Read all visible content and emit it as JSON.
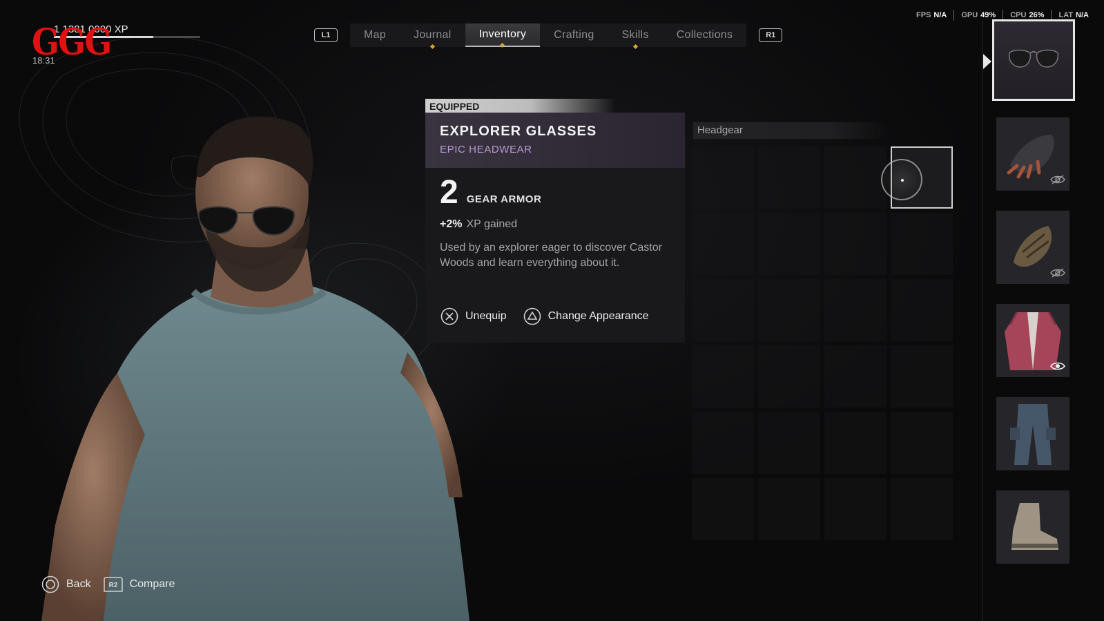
{
  "header": {
    "xp_text": "1 1381  0000 XP",
    "xp_progress": 0.68,
    "time": "18:31",
    "logo_text": "GGG"
  },
  "tabs": {
    "left_bumper": "L1",
    "right_bumper": "R1",
    "items": [
      {
        "label": "Map",
        "active": false,
        "dot": false
      },
      {
        "label": "Journal",
        "active": false,
        "dot": true
      },
      {
        "label": "Inventory",
        "active": true,
        "dot": true
      },
      {
        "label": "Crafting",
        "active": false,
        "dot": false
      },
      {
        "label": "Skills",
        "active": false,
        "dot": true
      },
      {
        "label": "Collections",
        "active": false,
        "dot": false
      }
    ]
  },
  "perf": {
    "fps_label": "FPS",
    "fps_value": "N/A",
    "gpu_label": "GPU",
    "gpu_value": "49%",
    "cpu_label": "CPU",
    "cpu_value": "26%",
    "lat_label": "LAT",
    "lat_value": "N/A"
  },
  "item": {
    "status": "EQUIPPED",
    "name": "EXPLORER GLASSES",
    "rarity": "EPIC HEADWEAR",
    "armor_value": "2",
    "armor_label": "GEAR ARMOR",
    "bonus_value": "+2%",
    "bonus_label": "XP gained",
    "description": "Used by an explorer eager to discover Castor Woods and learn everything about it.",
    "actions": {
      "unequip": "Unequip",
      "change_appearance": "Change Appearance"
    }
  },
  "inventory": {
    "slot_label": "Headgear"
  },
  "equipment": {
    "slots": [
      {
        "name": "glasses",
        "selected": true
      },
      {
        "name": "gloves",
        "visibility": "hidden"
      },
      {
        "name": "arm-guard",
        "visibility": "hidden"
      },
      {
        "name": "jacket",
        "visibility": "visible"
      },
      {
        "name": "pants"
      },
      {
        "name": "boots"
      }
    ]
  },
  "hints": {
    "back": "Back",
    "compare_button": "R2",
    "compare": "Compare"
  },
  "colors": {
    "epic": "#b99ad6",
    "tab_dot": "#d8a431",
    "logo_red": "#e21010"
  }
}
